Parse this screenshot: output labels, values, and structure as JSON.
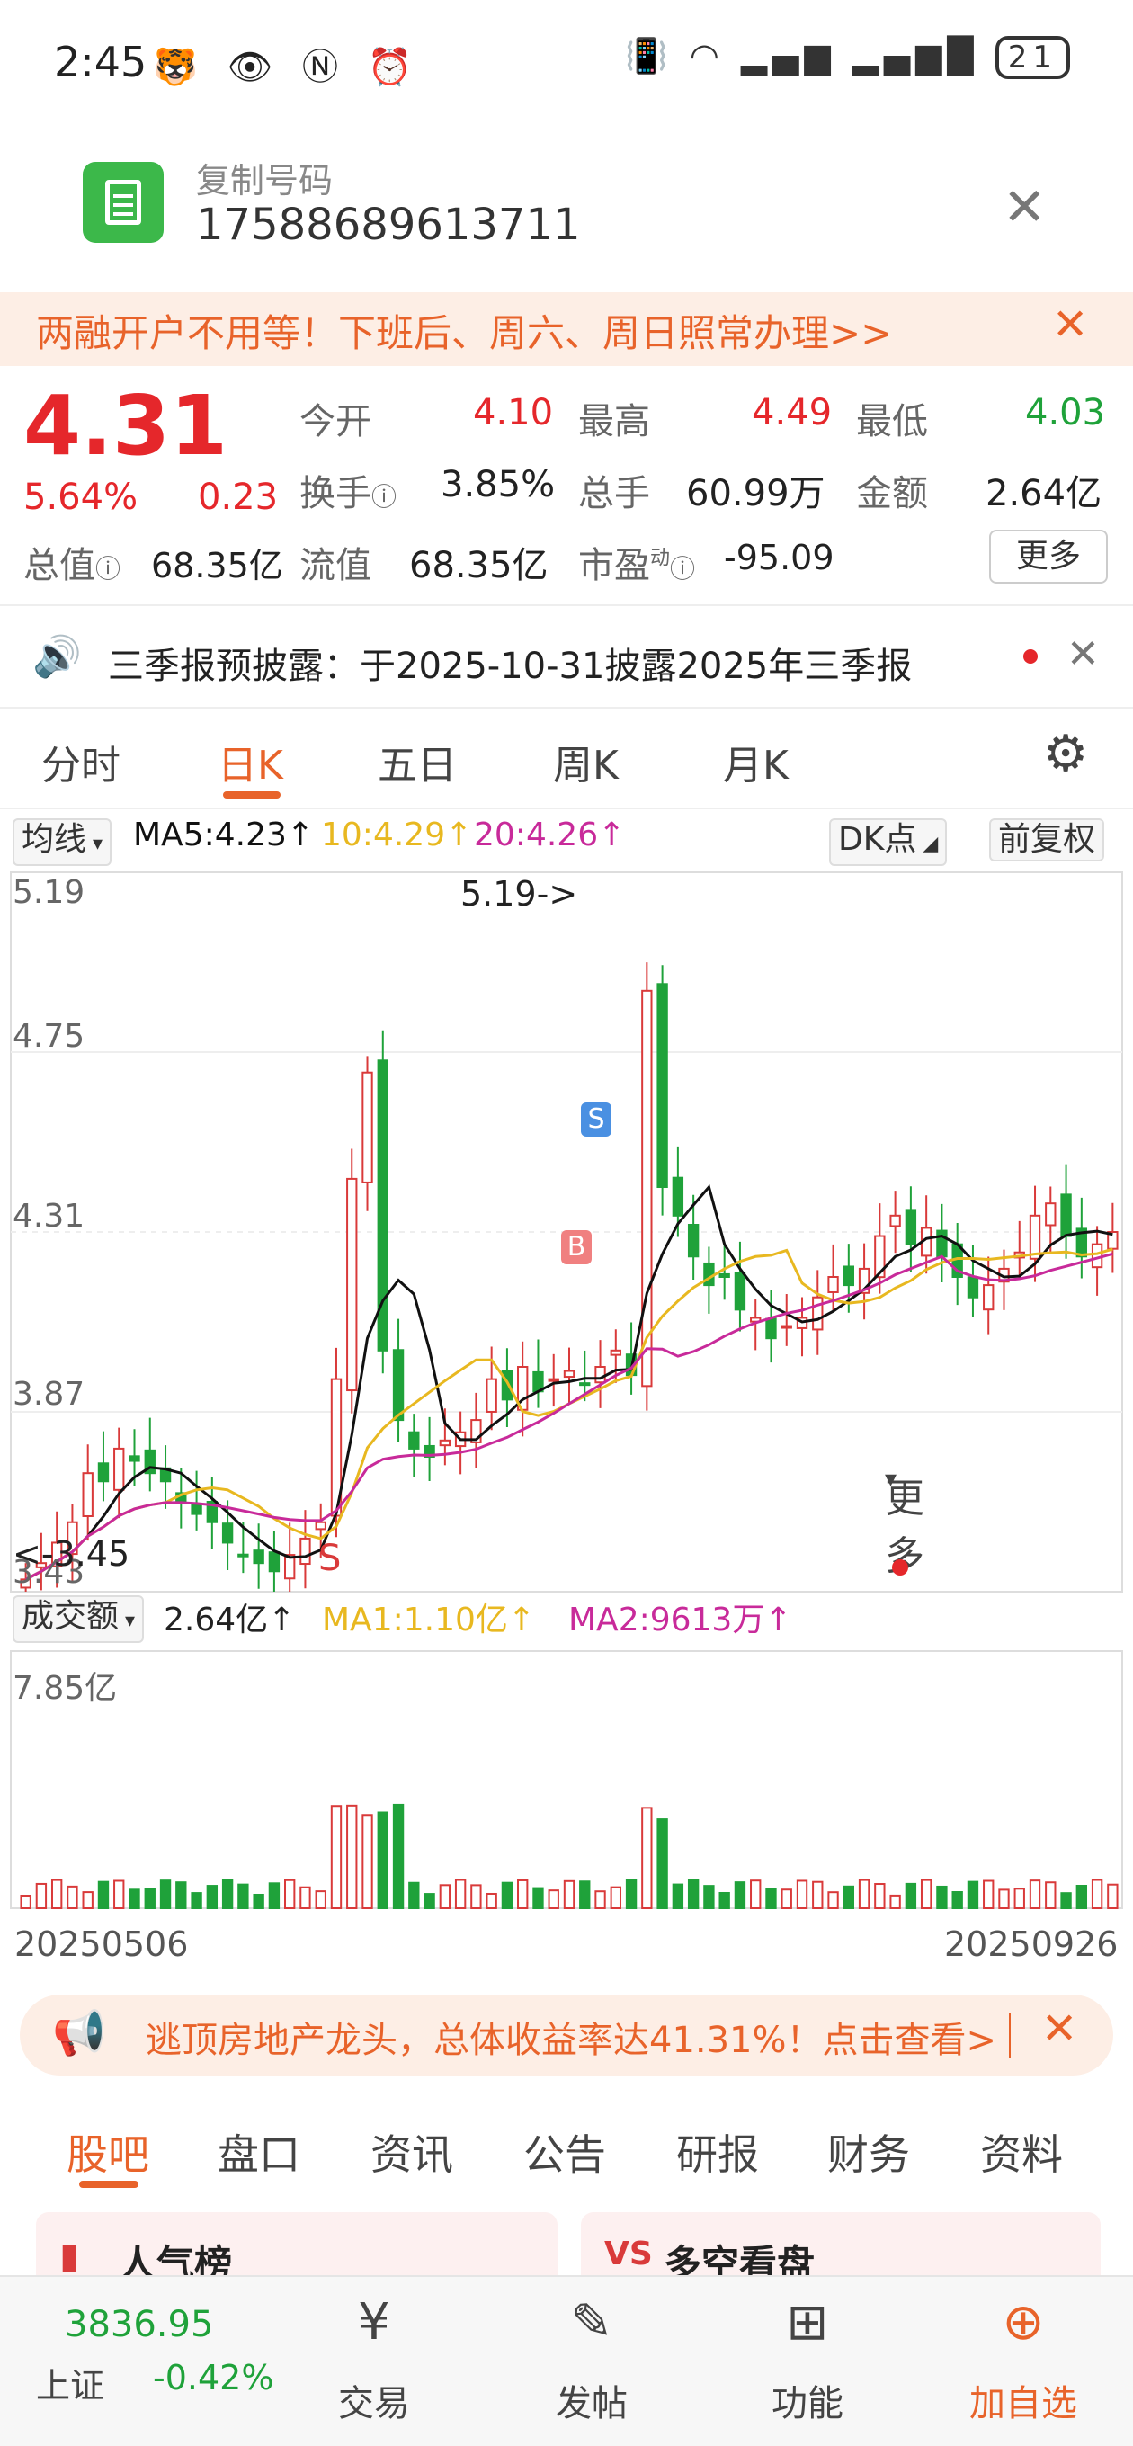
{
  "status_bar": {
    "time": "2:45",
    "battery": "21"
  },
  "copy_banner": {
    "label": "复制号码",
    "number": "17588689613711"
  },
  "ad_banner": {
    "text": "两融开户不用等！下班后、周六、周日照常办理>>"
  },
  "quote": {
    "price": "4.31",
    "change_pct": "5.64%",
    "change": "0.23",
    "open_label": "今开",
    "open": "4.10",
    "high_label": "最高",
    "high": "4.49",
    "low_label": "最低",
    "low": "4.03",
    "turnover_label": "换手",
    "turnover": "3.85%",
    "volume_label": "总手",
    "volume": "60.99万",
    "amount_label": "金额",
    "amount": "2.64亿",
    "mktcap_label": "总值",
    "mktcap": "68.35亿",
    "float_label": "流值",
    "float": "68.35亿",
    "pe_label": "市盈",
    "pe_sup": "动",
    "pe": "-95.09",
    "more": "更多"
  },
  "notice": {
    "text": "三季报预披露：于2025-10-31披露2025年三季报"
  },
  "period_tabs": [
    "分时",
    "日K",
    "五日",
    "周K",
    "月K",
    "更多"
  ],
  "active_period": "日K",
  "ma_bar": {
    "selector": "均线",
    "ma5": "MA5:4.23↑",
    "ma10": "10:4.29↑",
    "ma20": "20:4.26↑",
    "dk": "DK点",
    "adjust": "前复权"
  },
  "chart_data": {
    "type": "candlestick",
    "y_ticks": [
      "5.19",
      "4.75",
      "4.31",
      "3.87",
      "3.43"
    ],
    "ylim": [
      3.43,
      5.19
    ],
    "max_label": "5.19->",
    "min_label": "<-3.45",
    "x_start": "20250506",
    "x_end": "20250926",
    "signals": [
      "S",
      "B",
      "S"
    ],
    "close_approx": [
      3.46,
      3.5,
      3.55,
      3.6,
      3.72,
      3.7,
      3.78,
      3.75,
      3.72,
      3.7,
      3.65,
      3.62,
      3.6,
      3.55,
      3.52,
      3.5,
      3.48,
      3.52,
      3.56,
      3.6,
      3.95,
      4.44,
      4.7,
      4.02,
      3.85,
      3.78,
      3.76,
      3.8,
      3.82,
      3.85,
      3.95,
      3.9,
      3.98,
      3.92,
      3.95,
      3.97,
      3.94,
      3.98,
      4.02,
      3.96,
      4.9,
      4.42,
      4.35,
      4.25,
      4.18,
      4.2,
      4.12,
      4.1,
      4.05,
      4.08,
      4.1,
      4.15,
      4.2,
      4.18,
      4.22,
      4.3,
      4.35,
      4.28,
      4.32,
      4.25,
      4.2,
      4.15,
      4.18,
      4.22,
      4.26,
      4.35,
      4.38,
      4.3,
      4.25,
      4.28,
      4.31
    ],
    "volume_label": "成交额",
    "volume_value": "2.64亿↑",
    "ma1": "MA1:1.10亿↑",
    "ma2": "MA2:9613万↑",
    "volume_max": "7.85亿",
    "colors": {
      "up": "#d93a3a",
      "down": "#1fa23a",
      "ma5": "#111111",
      "ma10": "#e8b820",
      "ma20": "#c82a9a"
    }
  },
  "promo": {
    "text": "逃顶房地产龙头，总体收益率达41.31%！点击查看>"
  },
  "content_tabs": [
    "股吧",
    "盘口",
    "资讯",
    "公告",
    "研报",
    "财务",
    "资料"
  ],
  "cards": {
    "left": "人气榜",
    "right": "多空看盘"
  },
  "bottom_nav": {
    "index_value": "3836.95",
    "index_name": "上证",
    "index_change": "-0.42%",
    "trade": "交易",
    "post": "发帖",
    "func": "功能",
    "add": "加自选"
  }
}
